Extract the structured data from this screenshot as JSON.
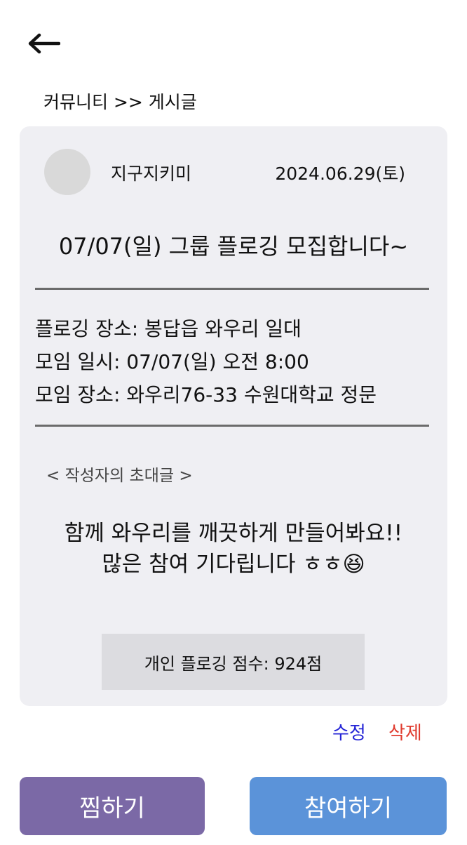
{
  "header": {
    "back_icon": "arrow-left-icon",
    "breadcrumb": "커뮤니티 >> 게시글"
  },
  "post": {
    "author": "지구지키미",
    "date": "2024.06.29(토)",
    "title": "07/07(일) 그룹 플로깅 모집합니다~",
    "details": [
      "플로깅 장소: 봉답읍 와우리 일대",
      "모임 일시: 07/07(일) 오전 8:00",
      "모임 장소: 와우리76-33 수원대학교 정문"
    ],
    "invite_label": "< 작성자의 초대글 >",
    "message_lines": [
      "함께 와우리를 깨끗하게 만들어봐요!!",
      "많은 참여 기다립니다 ㅎㅎ😆"
    ],
    "score": "개인 플로깅 점수: 924점"
  },
  "actions": {
    "edit_label": "수정",
    "delete_label": "삭제",
    "like_label": "찜하기",
    "join_label": "참여하기"
  },
  "colors": {
    "card_bg": "#efeff3",
    "edit": "#2424d6",
    "delete": "#e03b2e",
    "like_button": "#7b69a6",
    "join_button": "#5b93d9"
  }
}
